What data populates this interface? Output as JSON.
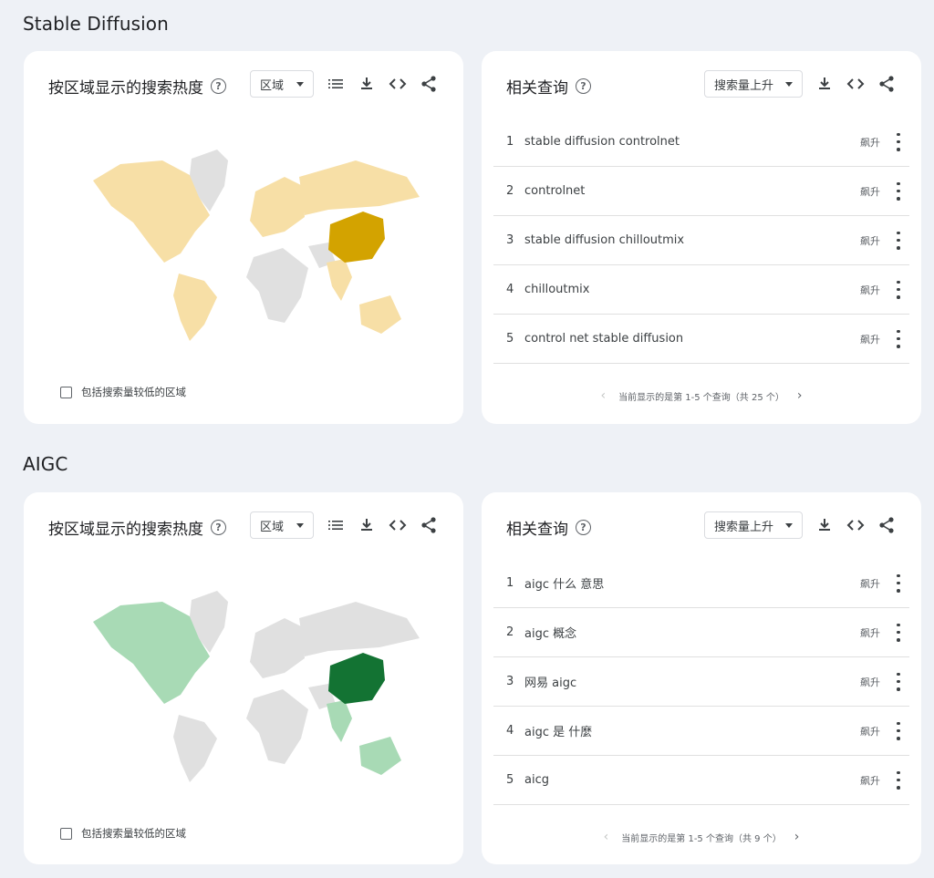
{
  "sections": [
    {
      "title": "Stable Diffusion",
      "map_card": {
        "title": "按区域显示的搜索热度",
        "dropdown": "区域",
        "low_volume_label": "包括搜索量较低的区域",
        "colors": {
          "base": "#f7dfa6",
          "highlight": "#d3a300",
          "none": "#e0e0e0"
        }
      },
      "queries_card": {
        "title": "相关查询",
        "dropdown": "搜索量上升",
        "rows": [
          {
            "num": "1",
            "text": "stable diffusion controlnet",
            "badge": "飙升"
          },
          {
            "num": "2",
            "text": "controlnet",
            "badge": "飙升"
          },
          {
            "num": "3",
            "text": "stable diffusion chilloutmix",
            "badge": "飙升"
          },
          {
            "num": "4",
            "text": "chilloutmix",
            "badge": "飙升"
          },
          {
            "num": "5",
            "text": "control net stable diffusion",
            "badge": "飙升"
          }
        ],
        "pager": "当前显示的是第 1-5 个查询（共 25 个）"
      }
    },
    {
      "title": "AIGC",
      "map_card": {
        "title": "按区域显示的搜索热度",
        "dropdown": "区域",
        "low_volume_label": "包括搜索量较低的区域",
        "colors": {
          "base": "#a8dab5",
          "highlight": "#137333",
          "none": "#e0e0e0"
        }
      },
      "queries_card": {
        "title": "相关查询",
        "dropdown": "搜索量上升",
        "rows": [
          {
            "num": "1",
            "text": "aigc 什么 意思",
            "badge": "飙升"
          },
          {
            "num": "2",
            "text": "aigc 概念",
            "badge": "飙升"
          },
          {
            "num": "3",
            "text": "网易 aigc",
            "badge": "飙升"
          },
          {
            "num": "4",
            "text": "aigc 是 什麼",
            "badge": "飙升"
          },
          {
            "num": "5",
            "text": "aicg",
            "badge": "飙升"
          }
        ],
        "pager": "当前显示的是第 1-5 个查询（共 9 个）"
      }
    }
  ],
  "icons": [
    "list-icon",
    "download-icon",
    "embed-icon",
    "share-icon",
    "help-icon",
    "chevron-left-icon",
    "chevron-right-icon",
    "more-vert-icon"
  ]
}
